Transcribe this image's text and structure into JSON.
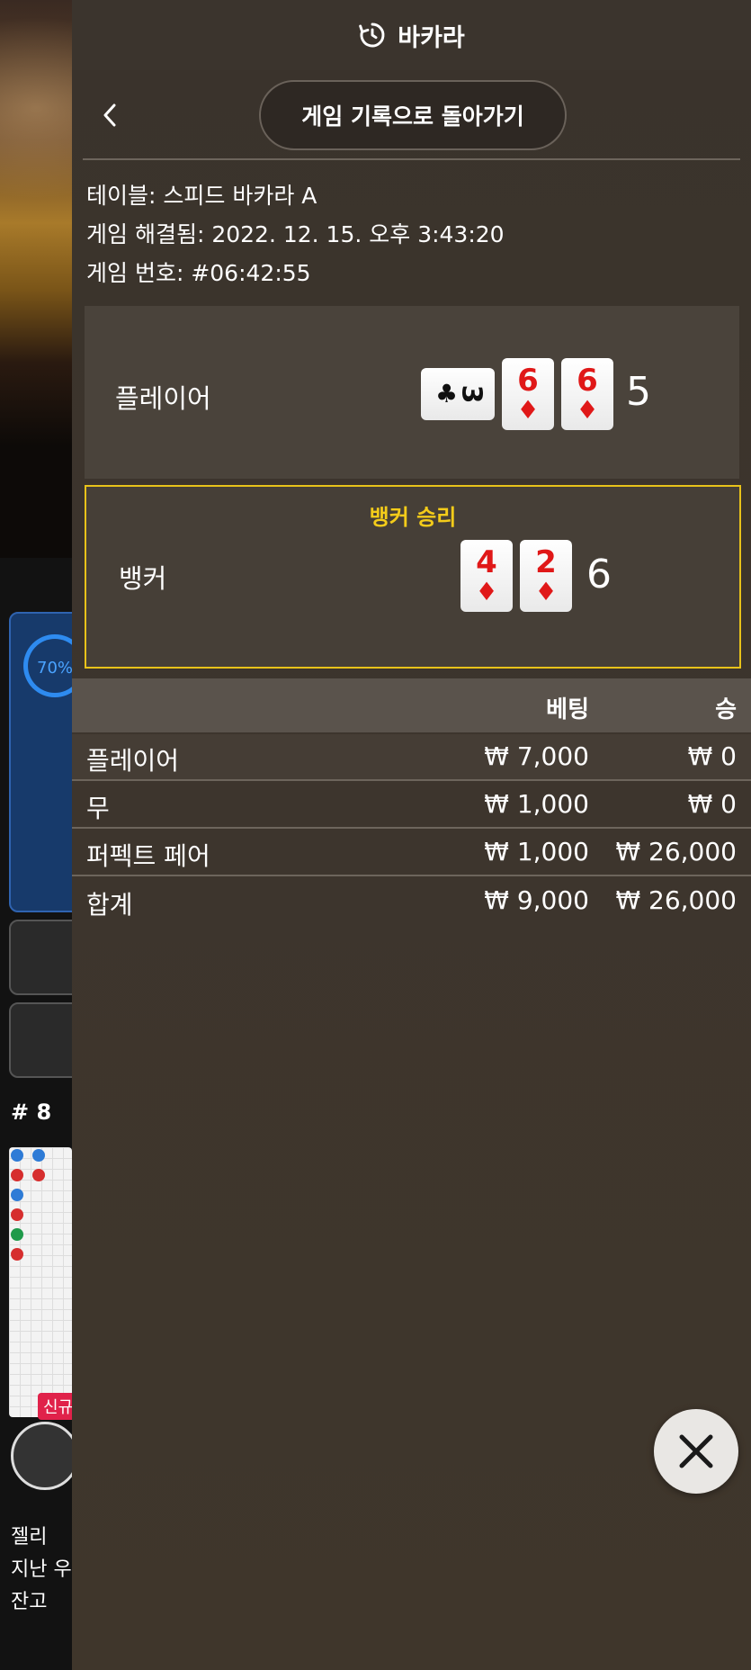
{
  "app": {
    "title": "바카라"
  },
  "nav": {
    "back_to_history_label": "게임 기록으로 돌아가기"
  },
  "details": {
    "table_label": "테이블:",
    "table_value": "스피드 바카라 A",
    "resolved_label": "게임 해결됨:",
    "resolved_value": "2022. 12. 15. 오후 3:43:20",
    "number_label": "게임 번호:",
    "number_value": "#06:42:55"
  },
  "result": {
    "player": {
      "label": "플레이어",
      "cards": [
        {
          "rank": "3",
          "suit": "♣",
          "color": "#111111",
          "orientation": "sideways"
        },
        {
          "rank": "6",
          "suit": "♦",
          "color": "#e01818",
          "orientation": "upright"
        },
        {
          "rank": "6",
          "suit": "♦",
          "color": "#e01818",
          "orientation": "upright"
        }
      ],
      "score": "5"
    },
    "banker": {
      "label": "뱅커",
      "winner_text": "뱅커 승리",
      "cards": [
        {
          "rank": "4",
          "suit": "♦",
          "color": "#e01818",
          "orientation": "upright"
        },
        {
          "rank": "2",
          "suit": "♦",
          "color": "#e01818",
          "orientation": "upright"
        }
      ],
      "score": "6"
    },
    "winner_color": "#e8c21a"
  },
  "bets": {
    "headers": {
      "bet": "베팅",
      "win": "승"
    },
    "rows": [
      {
        "name": "플레이어",
        "bet": "₩ 7,000",
        "win": "₩ 0"
      },
      {
        "name": "무",
        "bet": "₩ 1,000",
        "win": "₩ 0"
      },
      {
        "name": "퍼펙트 페어",
        "bet": "₩ 1,000",
        "win": "₩ 26,000"
      }
    ],
    "total": {
      "name": "합계",
      "bet": "₩ 9,000",
      "win": "₩ 26,000"
    }
  },
  "background": {
    "progress_text": "70%",
    "round_label": "# 8",
    "new_badge": "신규",
    "user_line": "젤리",
    "last_win_label": "지난 우승",
    "balance_label": "잔고"
  }
}
